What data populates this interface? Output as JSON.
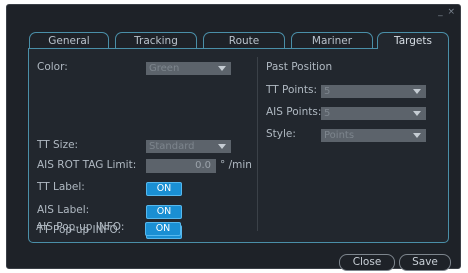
{
  "window": {
    "controls": "_ ×"
  },
  "tabs": [
    {
      "label": "General"
    },
    {
      "label": "Tracking"
    },
    {
      "label": "Route"
    },
    {
      "label": "Mariner"
    },
    {
      "label": "Targets"
    }
  ],
  "active_tab": "Targets",
  "left": {
    "color": {
      "label": "Color:",
      "value": "Green"
    },
    "tt_size": {
      "label": "TT Size:",
      "value": "Standard"
    },
    "ais_rot": {
      "label": "AIS ROT TAG Limit:",
      "value": "0.0",
      "unit": "° /min"
    },
    "tt_label": {
      "label": "TT Label:",
      "state": "ON"
    },
    "ais_label": {
      "label": "AIS Label:",
      "state": "ON"
    },
    "tt_popup": {
      "label": "TT Pop-up INFO:",
      "state": "ON"
    },
    "ais_popup": {
      "label": "AIS Pop-up INFO:",
      "state": "ON"
    }
  },
  "right": {
    "heading": "Past Position",
    "tt_points": {
      "label": "TT Points:",
      "value": "5"
    },
    "ais_points": {
      "label": "AIS Points:",
      "value": "5"
    },
    "style": {
      "label": "Style:",
      "value": "Points"
    }
  },
  "buttons": {
    "close": "Close",
    "save": "Save"
  },
  "colors": {
    "accent": "#1a8fd3",
    "border": "#4a8fa8",
    "background": "#1e2228"
  }
}
